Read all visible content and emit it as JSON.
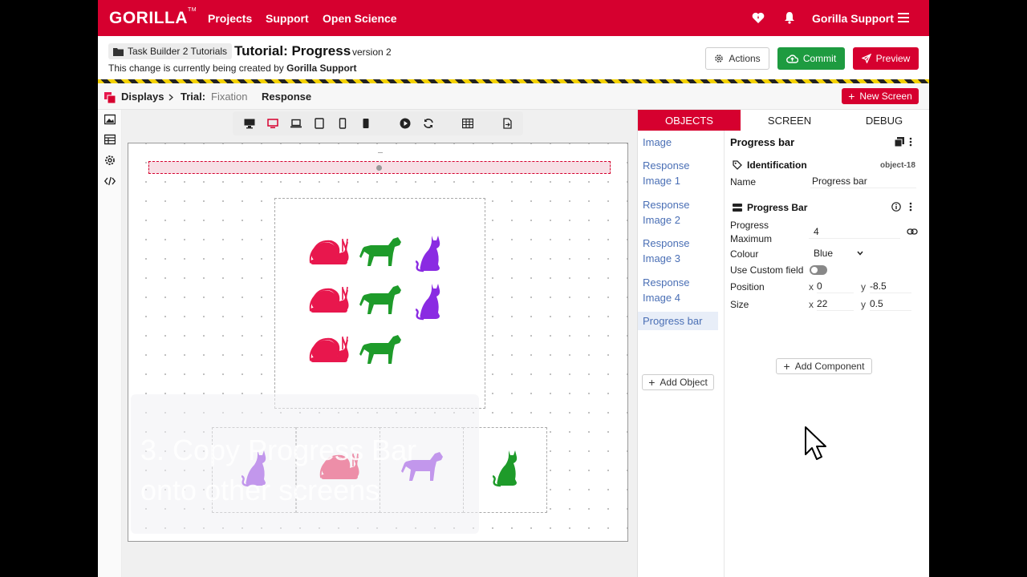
{
  "nav": {
    "logo": "GORILLA",
    "logo_tm": "TM",
    "links": [
      "Projects",
      "Support",
      "Open Science"
    ],
    "user": "Gorilla Support"
  },
  "header": {
    "folder_label": "Task Builder 2 Tutorials",
    "title": "Tutorial: Progress",
    "version": "version 2",
    "change_prefix": "This change is currently being created by",
    "change_user": "Gorilla Support",
    "actions_label": "Actions",
    "commit_label": "Commit",
    "preview_label": "Preview"
  },
  "subheader": {
    "displays": "Displays",
    "trial": "Trial:",
    "screens": [
      "Fixation",
      "Response"
    ],
    "new_screen_label": "New Screen"
  },
  "canvas": {
    "stimulus_grid": [
      [
        "snail",
        "dog",
        "cat"
      ],
      [
        "snail",
        "dog",
        "cat"
      ],
      [
        "snail",
        "dog",
        ""
      ]
    ],
    "responses": [
      "cat",
      "snail",
      "dog",
      "cat"
    ],
    "overlay_caption_line1": "3. Copy Progress Bar",
    "overlay_caption_line2": "onto other screens"
  },
  "colors": {
    "brand": "#d6002f",
    "snail": "#e8174d",
    "dog": "#1e9b2a",
    "cat": "#8a2be2",
    "commit": "#1e9b40"
  },
  "panel": {
    "tabs": [
      "OBJECTS",
      "SCREEN",
      "DEBUG"
    ],
    "objects": [
      "Image",
      "Response Image 1",
      "Response Image 2",
      "Response Image 3",
      "Response Image 4",
      "Progress bar"
    ],
    "add_object_label": "Add Object",
    "selected_title": "Progress bar",
    "identification_label": "Identification",
    "object_id": "object-18",
    "name_label": "Name",
    "name_value": "Progress bar",
    "component_label": "Progress Bar",
    "progress_max_label_1": "Progress",
    "progress_max_label_2": "Maximum",
    "progress_max_value": "4",
    "colour_label": "Colour",
    "colour_value": "Blue",
    "custom_field_label": "Use Custom field",
    "position_label": "Position",
    "position_x": "0",
    "position_y": "-8.5",
    "size_label": "Size",
    "size_x": "22",
    "size_y": "0.5",
    "x_label": "x",
    "y_label": "y",
    "add_component_label": "Add Component"
  }
}
